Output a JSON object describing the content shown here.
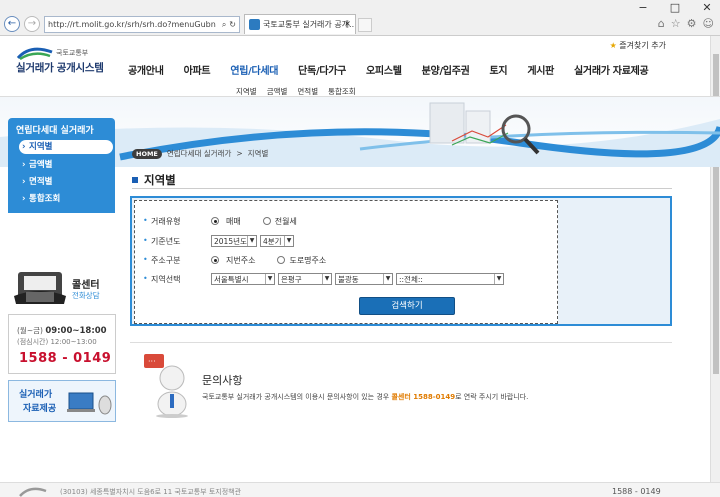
{
  "browser": {
    "url": "http://rt.molit.go.kr/srh/srh.do?menuGubn",
    "tab_title": "국토교통부 실거래가 공개...",
    "window_buttons": [
      "−",
      "□",
      "✕"
    ],
    "nav_back": "←",
    "nav_forward": "→",
    "search_glyph": "⌕",
    "refresh_glyph": "↻",
    "tab_close": "×",
    "toolbar_icons": [
      "⌂",
      "☆",
      "⚙",
      "☺"
    ]
  },
  "header": {
    "favorites_label": "즐겨찾기 추가",
    "org_name": "국토교통부",
    "system_name": "실거래가 공개시스템",
    "menu": [
      "공개안내",
      "아파트",
      "연립/다세대",
      "단독/다가구",
      "오피스텔",
      "분양/입주권",
      "토지",
      "게시판",
      "실거래가 자료제공"
    ],
    "active_menu_index": 2,
    "submenu": [
      "지역별",
      "금액별",
      "면적별",
      "통합조회"
    ]
  },
  "sidebar": {
    "title": "연립다세대 실거래가",
    "items": [
      {
        "label": "지역별",
        "active": true
      },
      {
        "label": "금액별",
        "active": false
      },
      {
        "label": "면적별",
        "active": false
      },
      {
        "label": "통합조회",
        "active": false
      }
    ],
    "call_center": {
      "title": "콜센터",
      "subtitle": "전화상담",
      "hours_days": "(월~금)",
      "hours": "09:00~18:00",
      "lunch": "(점심시간) 12:00~13:00",
      "number": "1588 - 0149"
    },
    "data_provision": {
      "line1": "실거래가",
      "line2": "자료제공"
    }
  },
  "breadcrumb": {
    "home": "HOME",
    "items": [
      "연립다세대 실거래가",
      "지역별"
    ],
    "separator": ">"
  },
  "page_title": "지역별",
  "search_form": {
    "trade_type": {
      "label": "거래유형",
      "options": [
        {
          "label": "매매",
          "selected": true
        },
        {
          "label": "전월세",
          "selected": false
        }
      ]
    },
    "period": {
      "label": "기준년도",
      "year": "2015년도",
      "quarter": "4분기"
    },
    "address_type": {
      "label": "주소구분",
      "options": [
        {
          "label": "지번주소",
          "selected": true
        },
        {
          "label": "도로명주소",
          "selected": false
        }
      ]
    },
    "region": {
      "label": "지역선택",
      "sido": "서울특별시",
      "sigungu": "은평구",
      "dong": "불광동",
      "complex": "::전체::"
    },
    "submit_label": "검색하기"
  },
  "inquiry": {
    "title": "문의사항",
    "desc_prefix": "국토교통부 실거래가 공개시스템의 이용시 문의사항이 있는 경우",
    "desc_highlight": "콜센터 1588-0149",
    "desc_suffix": "로 연락 주시기 바랍니다."
  },
  "footer": {
    "text": "(30103) 세종특별자치시 도움6로 11 국토교통부 토지정책관",
    "phone": "1588 - 0149"
  },
  "colors": {
    "primary": "#2d8cd6",
    "accent_red": "#c8102e",
    "highlight": "#e07b00"
  }
}
